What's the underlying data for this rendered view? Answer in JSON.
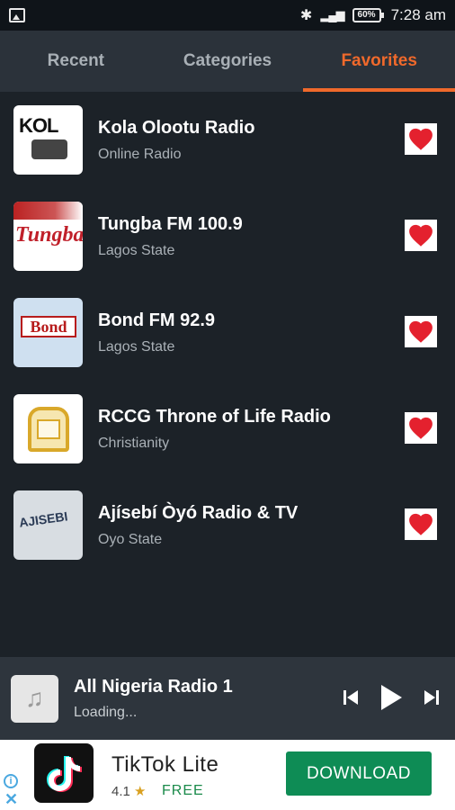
{
  "status_bar": {
    "battery": "60%",
    "time": "7:28 am"
  },
  "tabs": [
    {
      "label": "Recent",
      "active": false
    },
    {
      "label": "Categories",
      "active": false
    },
    {
      "label": "Favorites",
      "active": true
    }
  ],
  "favorites": [
    {
      "title": "Kola Olootu Radio",
      "subtitle": "Online Radio",
      "logo_text": "KOL",
      "favorited": true
    },
    {
      "title": "Tungba FM 100.9",
      "subtitle": "Lagos State",
      "logo_text": "Tungba",
      "favorited": true
    },
    {
      "title": "Bond FM 92.9",
      "subtitle": "Lagos State",
      "logo_text": "Bond",
      "favorited": true
    },
    {
      "title": "RCCG Throne of Life Radio",
      "subtitle": "Christianity",
      "logo_text": "",
      "favorited": true
    },
    {
      "title": "Ajísebí Òyó Radio & TV",
      "subtitle": "Oyo State",
      "logo_text": "AJISEBI",
      "favorited": true
    }
  ],
  "player": {
    "title": "All Nigeria Radio 1",
    "status": "Loading..."
  },
  "ad": {
    "app_name": "TikTok Lite",
    "rating": "4.1",
    "price": "FREE",
    "button_label": "DOWNLOAD"
  },
  "colors": {
    "accent": "#f0692b",
    "heart": "#e4212e",
    "background": "#1c2228",
    "download": "#0e8c55"
  }
}
